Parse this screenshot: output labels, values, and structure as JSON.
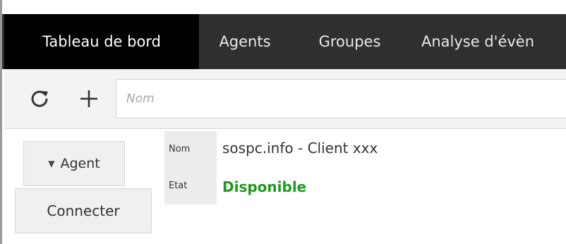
{
  "nav": {
    "tabs": [
      {
        "label": "Tableau de bord",
        "active": true
      },
      {
        "label": "Agents",
        "active": false
      },
      {
        "label": "Groupes",
        "active": false
      },
      {
        "label": "Analyse d'évèn",
        "active": false
      }
    ]
  },
  "toolbar": {
    "refresh_icon": "refresh-icon",
    "add_icon": "plus-icon",
    "search_placeholder": "Nom",
    "search_value": ""
  },
  "agent_panel": {
    "agent_button_label": "Agent",
    "connect_button_label": "Connecter"
  },
  "info": {
    "name_label": "Nom",
    "name_value": "sospc.info - Client xxx",
    "state_label": "Etat",
    "state_value": "Disponible",
    "state_color": "#1e9a1e"
  },
  "colors": {
    "navbar_bg": "#2f2f2f",
    "active_tab_bg": "#000000"
  }
}
